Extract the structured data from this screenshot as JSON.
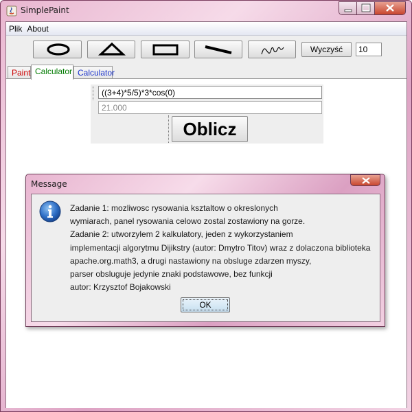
{
  "window": {
    "title": "SimplePaint"
  },
  "menu": {
    "items": [
      "Plik",
      "About"
    ]
  },
  "toolbar": {
    "tools": [
      "ellipse-icon",
      "triangle-icon",
      "rectangle-icon",
      "line-icon",
      "freehand-icon"
    ],
    "clear_label": "Wyczyść",
    "size_value": "10"
  },
  "tabs": [
    {
      "label": "Paint",
      "color": "#cc0000"
    },
    {
      "label": "Calculator",
      "color": "#007a00"
    },
    {
      "label": "Calculator",
      "color": "#1a33cc"
    }
  ],
  "calculator": {
    "expression": "((3+4)*5/5)*3*cos(0)",
    "result": "21.000",
    "compute_label": "Oblicz"
  },
  "dialog": {
    "title": "Message",
    "icon": "info-icon",
    "lines": [
      "Zadanie 1: mozliwosc rysowania ksztaltow o okreslonych",
      "wymiarach, panel rysowania celowo zostal zostawiony na gorze.",
      "Zadanie 2: utworzylem 2 kalkulatory, jeden z wykorzystaniem",
      "implementacji algorytmu Dijikstry (autor: Dmytro Titov) wraz z dolaczona biblioteka",
      "apache.org.math3, a drugi nastawiony na obsluge zdarzen myszy,",
      "parser obsluguje jedynie znaki podstawowe, bez funkcji",
      "autor: Krzysztof Bojakowski"
    ],
    "ok_label": "OK"
  }
}
